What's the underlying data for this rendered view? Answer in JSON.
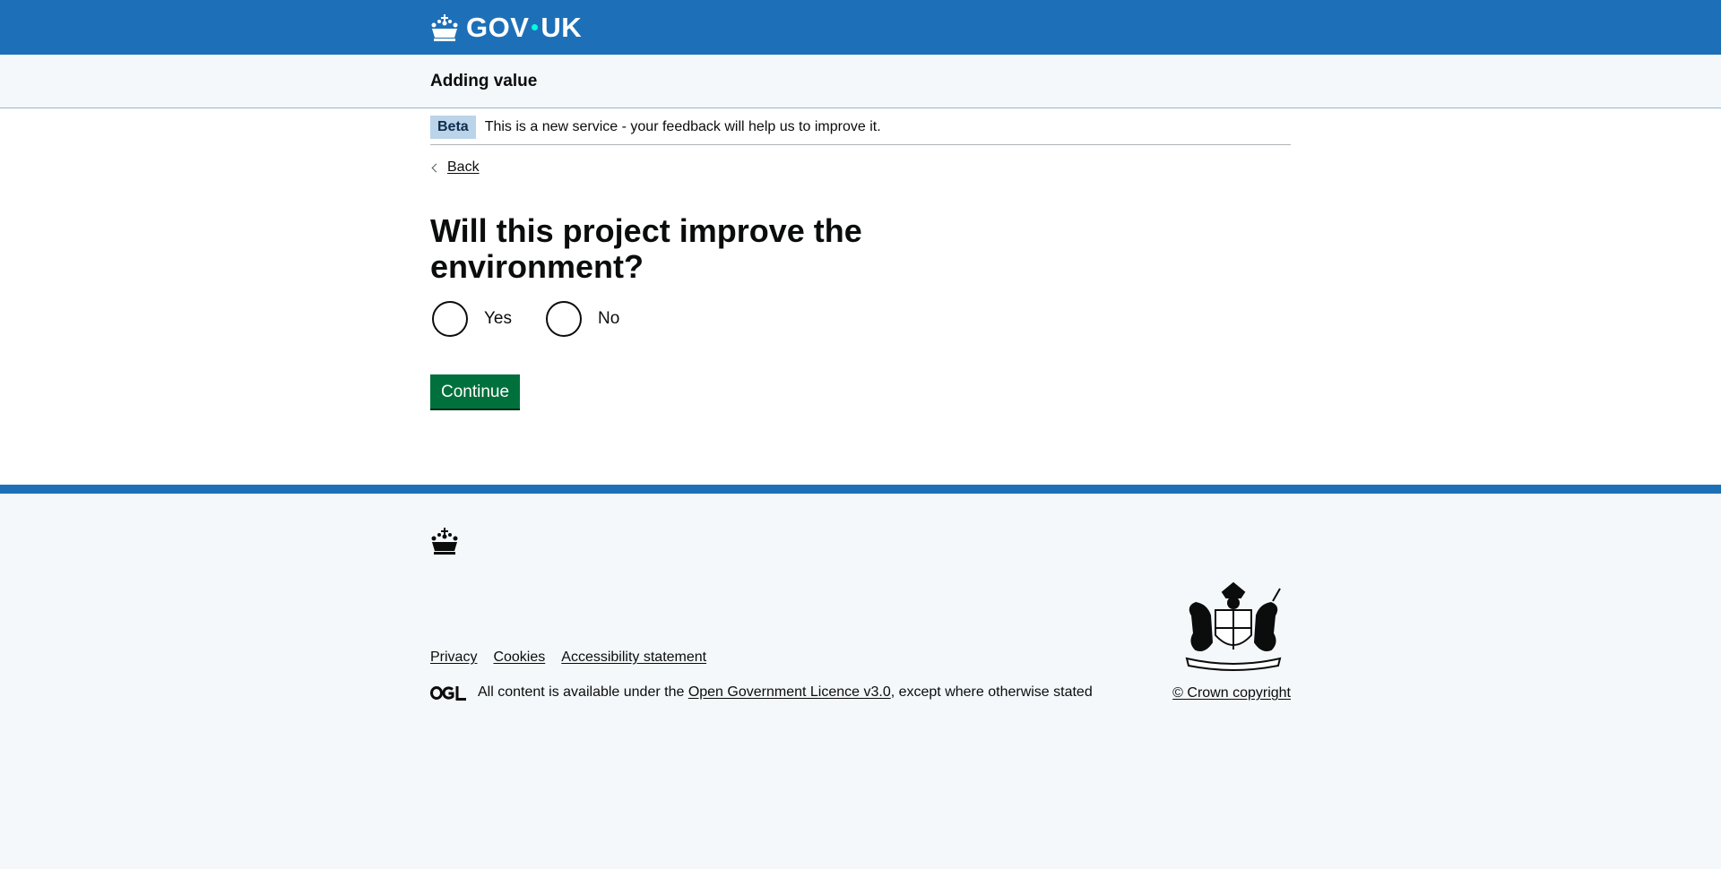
{
  "header": {
    "logo_gov": "GOV",
    "logo_uk": "UK",
    "brand_color": "#1d70b8"
  },
  "service_nav": {
    "service_name": "Adding value"
  },
  "phase_banner": {
    "tag": "Beta",
    "text": "This is a new service - your feedback will help us to improve it."
  },
  "back_link": "Back",
  "question": {
    "heading": "Will this project improve the environment?",
    "options": [
      {
        "label": "Yes",
        "checked": false
      },
      {
        "label": "No",
        "checked": false
      }
    ]
  },
  "continue_button": {
    "label": "Continue",
    "color": "#00703c"
  },
  "footer": {
    "links": [
      "Privacy",
      "Cookies",
      "Accessibility statement"
    ],
    "licence_prefix": "All content is available under the ",
    "licence_link": "Open Government Licence v3.0",
    "licence_suffix": ", except where otherwise stated",
    "copyright": "© Crown copyright"
  }
}
